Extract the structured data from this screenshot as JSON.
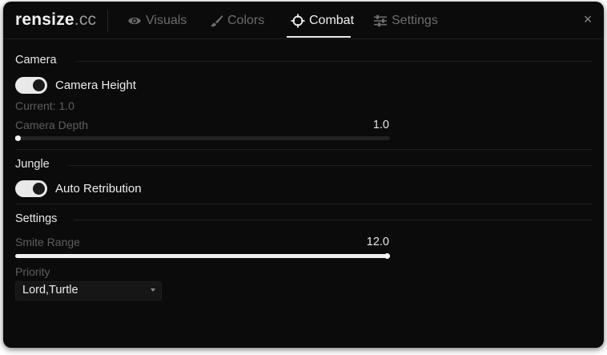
{
  "app": {
    "logo_main": "rensize",
    "logo_sub": ".cc"
  },
  "tabs": [
    {
      "label": "Visuals",
      "icon": "eye-icon"
    },
    {
      "label": "Colors",
      "icon": "brush-icon"
    },
    {
      "label": "Combat",
      "icon": "crosshair-icon",
      "active": true
    },
    {
      "label": "Settings",
      "icon": "sliders-icon"
    }
  ],
  "close_label": "×",
  "camera": {
    "title": "Camera",
    "height_toggle_label": "Camera Height",
    "height_toggle_on": true,
    "current_text": "Current: 1.0",
    "depth_label": "Camera Depth",
    "depth_value": "1.0",
    "depth_fill_fraction": 0.0
  },
  "jungle": {
    "title": "Jungle",
    "auto_retribution_label": "Auto Retribution",
    "auto_retribution_on": true
  },
  "settings": {
    "title": "Settings",
    "smite_range_label": "Smite Range",
    "smite_range_value": "12.0",
    "smite_range_fill_fraction": 1.0,
    "priority_label": "Priority",
    "priority_value": "Lord,Turtle"
  },
  "colors": {
    "background": "#0b0b0b",
    "accent": "#f0f0f0",
    "muted_text": "#5e5e5e"
  }
}
